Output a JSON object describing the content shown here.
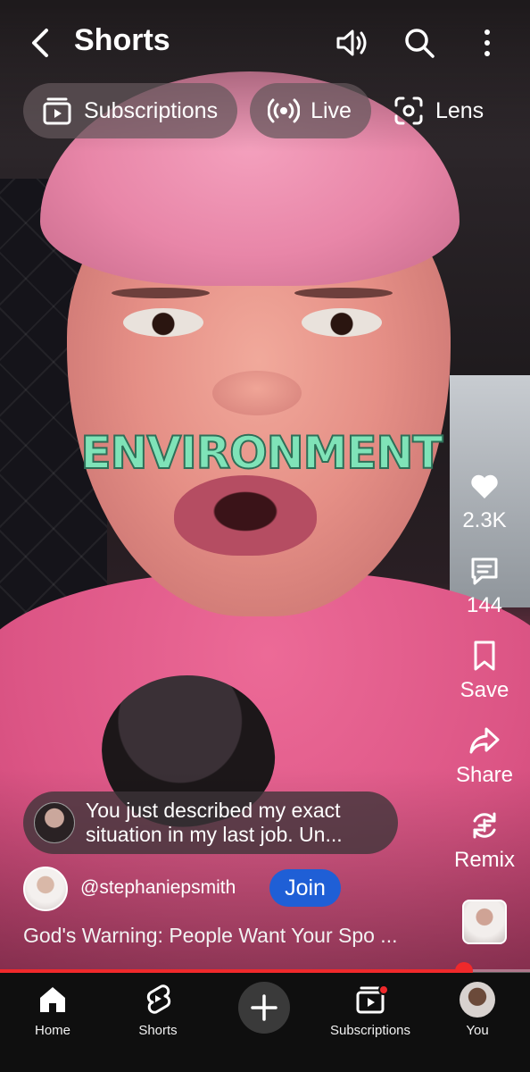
{
  "header": {
    "title": "Shorts"
  },
  "chips": [
    {
      "label": "Subscriptions",
      "icon": "subscriptions-icon"
    },
    {
      "label": "Live",
      "icon": "live-icon"
    },
    {
      "label": "Lens",
      "icon": "lens-icon"
    }
  ],
  "video": {
    "overlay_text": "ENVIRONMENT",
    "progress": 0.875
  },
  "actions": {
    "like_count": "2.3K",
    "comment_count": "144",
    "save_label": "Save",
    "share_label": "Share",
    "remix_label": "Remix"
  },
  "comment": {
    "text": "You just described my exact situation in my last job. Un..."
  },
  "channel": {
    "handle": "@stephaniepsmith",
    "join_label": "Join"
  },
  "video_title": "God's Warning: People Want Your Spo ...",
  "bottom_nav": [
    {
      "label": "Home",
      "icon": "home-icon"
    },
    {
      "label": "Shorts",
      "icon": "shorts-icon"
    },
    {
      "label": "",
      "icon": "plus-icon"
    },
    {
      "label": "Subscriptions",
      "icon": "subscriptions-icon"
    },
    {
      "label": "You",
      "icon": "avatar"
    }
  ],
  "colors": {
    "accent_red": "#f0292b",
    "join_blue": "#1f5fd6",
    "caption_green": "#7fe3b8"
  }
}
